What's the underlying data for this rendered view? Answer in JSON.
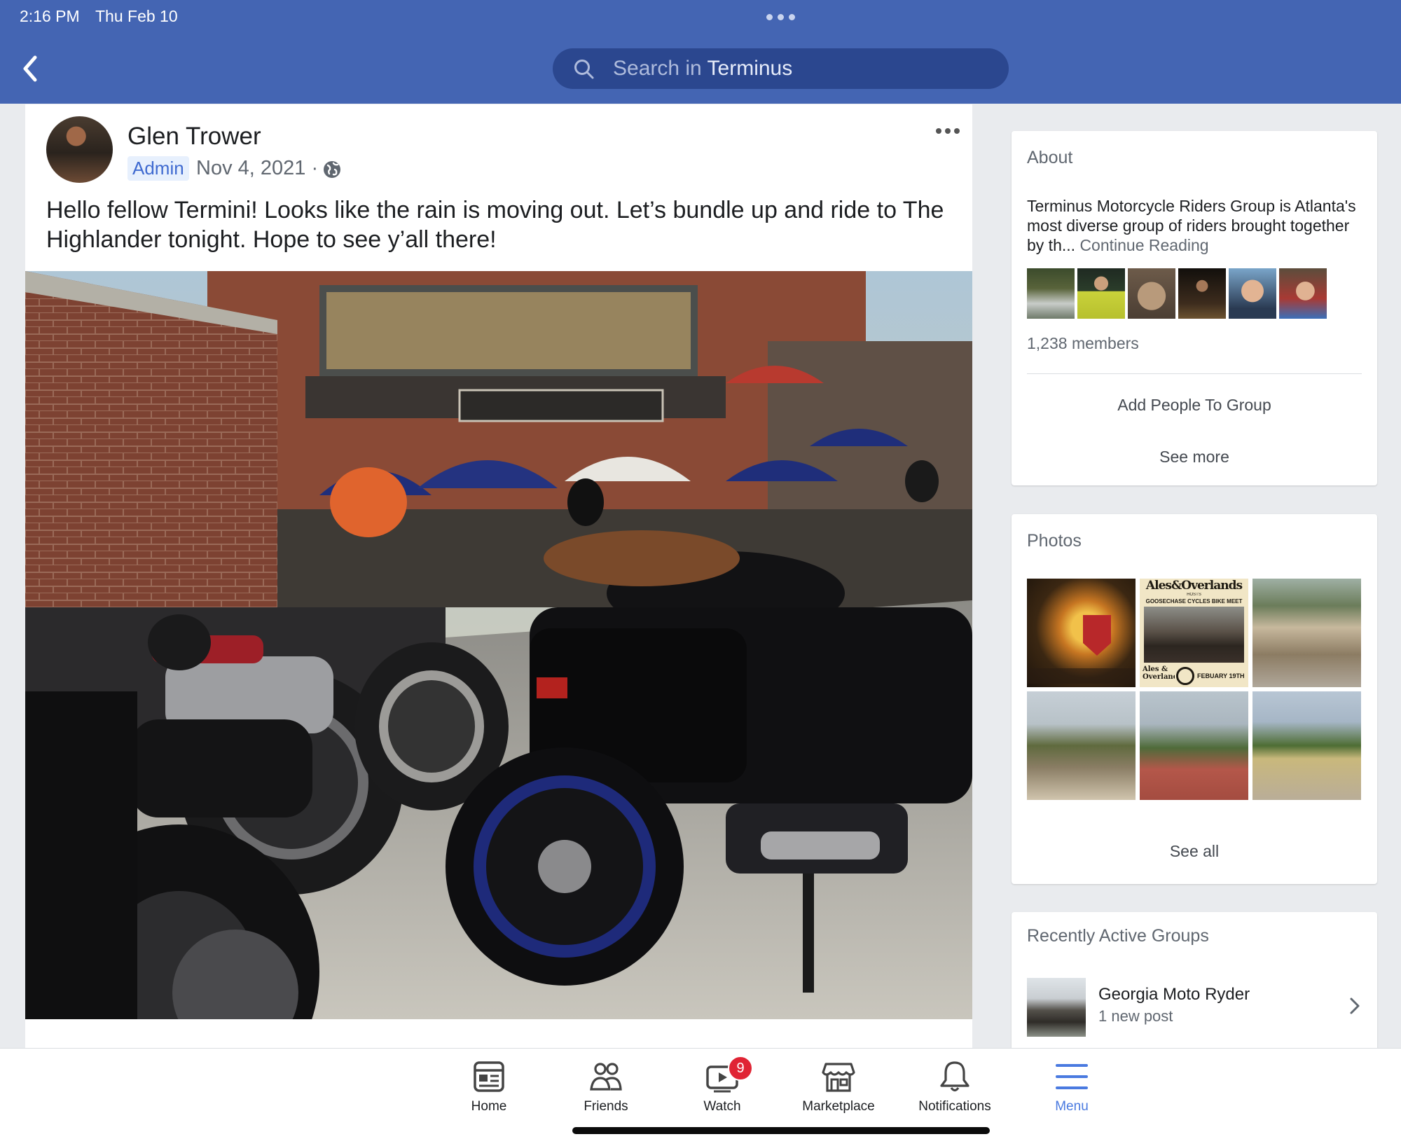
{
  "status_bar": {
    "time": "2:16 PM",
    "date": "Thu Feb 10"
  },
  "search": {
    "prefix": "Search in ",
    "group": "Terminus"
  },
  "post": {
    "author": "Glen Trower",
    "role": "Admin",
    "date": "Nov 4, 2021 ·",
    "text": "Hello fellow Termini! Looks like the rain is moving out. Let’s bundle up and ride to The Highlander tonight. Hope to see y’all there!"
  },
  "about": {
    "title": "About",
    "description": "Terminus Motorcycle Riders Group is Atlanta's most diverse group of riders brought together by th...",
    "continue": "Continue Reading",
    "members": "1,238 members",
    "add_people": "Add People To Group",
    "see_more": "See more"
  },
  "photos": {
    "title": "Photos",
    "see_all": "See all",
    "event_poster": {
      "title": "Ales&Overlands",
      "hosts": "HOSTS",
      "subtitle": "GOOSECHASE CYCLES BIKE MEET",
      "logo": "Ales & Overlands",
      "date": "FEBUARY 19TH"
    }
  },
  "recent_groups": {
    "title": "Recently Active Groups",
    "items": [
      {
        "name": "Georgia Moto Ryder",
        "meta": "1 new post"
      }
    ]
  },
  "tabbar": {
    "items": [
      {
        "label": "Home",
        "icon": "home-feed-icon"
      },
      {
        "label": "Friends",
        "icon": "friends-icon"
      },
      {
        "label": "Watch",
        "icon": "watch-video-icon",
        "badge": "9"
      },
      {
        "label": "Marketplace",
        "icon": "marketplace-shop-icon"
      },
      {
        "label": "Notifications",
        "icon": "bell-icon"
      },
      {
        "label": "Menu",
        "icon": "hamburger-menu-icon",
        "active": true
      }
    ]
  },
  "colors": {
    "header": "#4465b3",
    "search_bg": "#2b478f",
    "accent": "#4a7ae0",
    "badge": "#e02434",
    "admin_badge_text": "#3f6ad0"
  }
}
